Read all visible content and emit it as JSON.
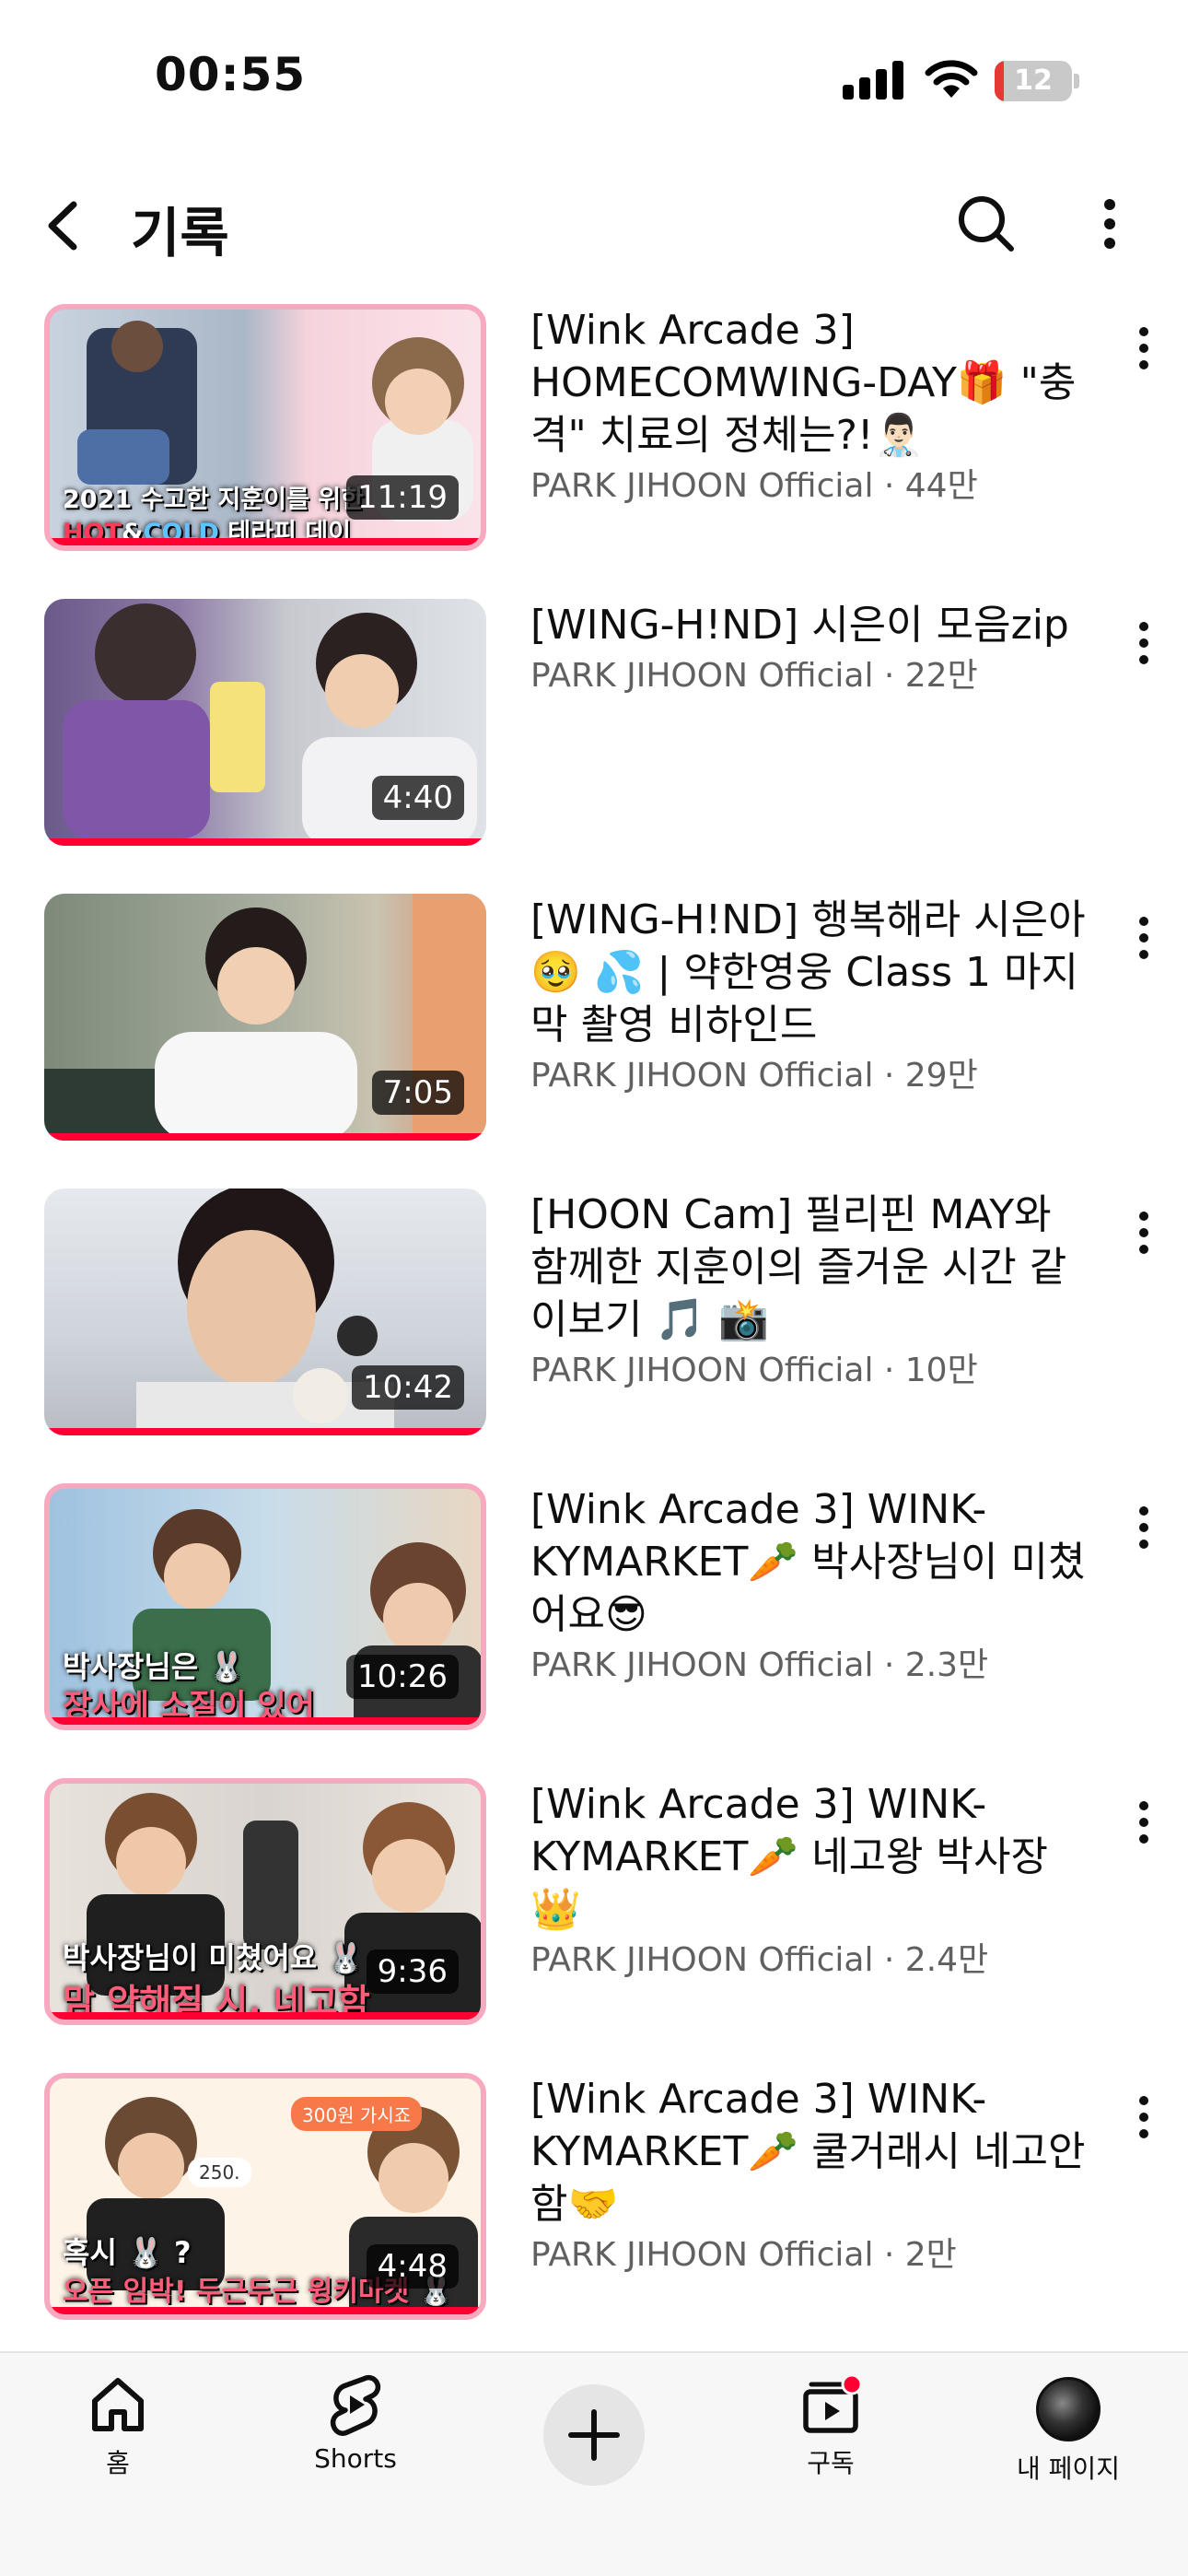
{
  "status_bar": {
    "time": "00:55",
    "battery": "12",
    "battery_level": 0.12
  },
  "header": {
    "title": "기록"
  },
  "videos": [
    {
      "title": "[Wink Arcade 3] HOMECOMWING-DAY🎁 \"충격\" 치료의 정체는?!👨🏻‍⚕️",
      "subtitle": "PARK JIHOON Official · 44만",
      "duration": "11:19",
      "caption_line1": "2021 수고한 지훈이를 위한",
      "caption_hot": "HOT",
      "caption_amp": "&",
      "caption_cold": "COLD",
      "caption_rest": " 테라피 데이",
      "progress": 1.0
    },
    {
      "title": "[WING-H!ND] 시은이 모음zip",
      "subtitle": "PARK JIHOON Official · 22만",
      "duration": "4:40",
      "progress": 1.0
    },
    {
      "title": "[WING-H!ND] 행복해라 시은아🥹 💦 | 약한영웅 Class 1 마지막 촬영 비하인드",
      "subtitle": "PARK JIHOON Official · 29만",
      "duration": "7:05",
      "progress": 1.0
    },
    {
      "title": "[HOON Cam] 필리핀 MAY와 함께한 지훈이의 즐거운 시간 같이보기 🎵 📸",
      "subtitle": "PARK JIHOON Official · 10만",
      "duration": "10:42",
      "progress": 1.0
    },
    {
      "title": "[Wink Arcade 3] WINK-KYMARKET🥕 박사장님이 미쳤어요😎",
      "subtitle": "PARK JIHOON Official · 2.3만",
      "duration": "10:26",
      "caption_line1": "박사장님은 🐰",
      "caption_line2": "장사에 소질이 있어",
      "progress": 1.0
    },
    {
      "title": "[Wink Arcade 3] WINK-KYMARKET🥕 네고왕 박사장 👑",
      "subtitle": "PARK JIHOON Official · 2.4만",
      "duration": "9:36",
      "caption_line1": "박사장님이 미쳤어요 🐰",
      "caption_line2": "맘 약해질 시, 네고함",
      "progress": 1.0
    },
    {
      "title": "[Wink Arcade 3] WINK-KYMARKET🥕 쿨거래시 네고안함🤝",
      "subtitle": "PARK JIHOON Official · 2만",
      "duration": "4:48",
      "caption_line1": "혹시 🐰 ?",
      "caption_line2": "오픈 임박! 두근두근 윙키마켓 🐰",
      "bubble1": "300원 가시죠",
      "bubble2": "250.",
      "progress": 1.0
    }
  ],
  "bottom_nav": {
    "home": "홈",
    "shorts": "Shorts",
    "subscriptions": "구독",
    "my_page": "내 페이지"
  },
  "colors": {
    "accent": "#ff0033",
    "text_primary": "#0f0f0f",
    "text_secondary": "#606060"
  },
  "icons": [
    "back-arrow-icon",
    "search-icon",
    "more-vert-icon",
    "home-icon",
    "shorts-icon",
    "plus-icon",
    "subscriptions-icon"
  ]
}
